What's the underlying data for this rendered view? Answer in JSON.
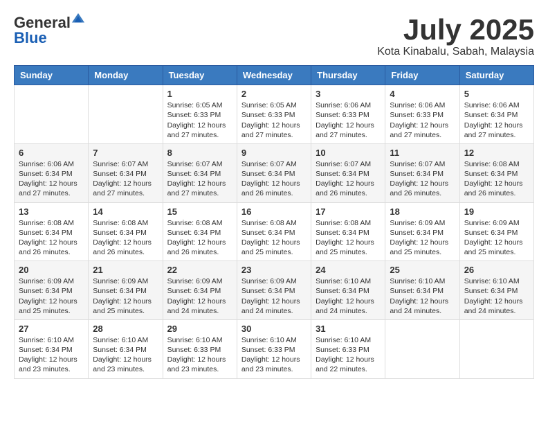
{
  "logo": {
    "general": "General",
    "blue": "Blue"
  },
  "header": {
    "month": "July 2025",
    "location": "Kota Kinabalu, Sabah, Malaysia"
  },
  "days_of_week": [
    "Sunday",
    "Monday",
    "Tuesday",
    "Wednesday",
    "Thursday",
    "Friday",
    "Saturday"
  ],
  "weeks": [
    [
      {
        "day": "",
        "sunrise": "",
        "sunset": "",
        "daylight": ""
      },
      {
        "day": "",
        "sunrise": "",
        "sunset": "",
        "daylight": ""
      },
      {
        "day": "1",
        "sunrise": "Sunrise: 6:05 AM",
        "sunset": "Sunset: 6:33 PM",
        "daylight": "Daylight: 12 hours and 27 minutes."
      },
      {
        "day": "2",
        "sunrise": "Sunrise: 6:05 AM",
        "sunset": "Sunset: 6:33 PM",
        "daylight": "Daylight: 12 hours and 27 minutes."
      },
      {
        "day": "3",
        "sunrise": "Sunrise: 6:06 AM",
        "sunset": "Sunset: 6:33 PM",
        "daylight": "Daylight: 12 hours and 27 minutes."
      },
      {
        "day": "4",
        "sunrise": "Sunrise: 6:06 AM",
        "sunset": "Sunset: 6:33 PM",
        "daylight": "Daylight: 12 hours and 27 minutes."
      },
      {
        "day": "5",
        "sunrise": "Sunrise: 6:06 AM",
        "sunset": "Sunset: 6:34 PM",
        "daylight": "Daylight: 12 hours and 27 minutes."
      }
    ],
    [
      {
        "day": "6",
        "sunrise": "Sunrise: 6:06 AM",
        "sunset": "Sunset: 6:34 PM",
        "daylight": "Daylight: 12 hours and 27 minutes."
      },
      {
        "day": "7",
        "sunrise": "Sunrise: 6:07 AM",
        "sunset": "Sunset: 6:34 PM",
        "daylight": "Daylight: 12 hours and 27 minutes."
      },
      {
        "day": "8",
        "sunrise": "Sunrise: 6:07 AM",
        "sunset": "Sunset: 6:34 PM",
        "daylight": "Daylight: 12 hours and 27 minutes."
      },
      {
        "day": "9",
        "sunrise": "Sunrise: 6:07 AM",
        "sunset": "Sunset: 6:34 PM",
        "daylight": "Daylight: 12 hours and 26 minutes."
      },
      {
        "day": "10",
        "sunrise": "Sunrise: 6:07 AM",
        "sunset": "Sunset: 6:34 PM",
        "daylight": "Daylight: 12 hours and 26 minutes."
      },
      {
        "day": "11",
        "sunrise": "Sunrise: 6:07 AM",
        "sunset": "Sunset: 6:34 PM",
        "daylight": "Daylight: 12 hours and 26 minutes."
      },
      {
        "day": "12",
        "sunrise": "Sunrise: 6:08 AM",
        "sunset": "Sunset: 6:34 PM",
        "daylight": "Daylight: 12 hours and 26 minutes."
      }
    ],
    [
      {
        "day": "13",
        "sunrise": "Sunrise: 6:08 AM",
        "sunset": "Sunset: 6:34 PM",
        "daylight": "Daylight: 12 hours and 26 minutes."
      },
      {
        "day": "14",
        "sunrise": "Sunrise: 6:08 AM",
        "sunset": "Sunset: 6:34 PM",
        "daylight": "Daylight: 12 hours and 26 minutes."
      },
      {
        "day": "15",
        "sunrise": "Sunrise: 6:08 AM",
        "sunset": "Sunset: 6:34 PM",
        "daylight": "Daylight: 12 hours and 26 minutes."
      },
      {
        "day": "16",
        "sunrise": "Sunrise: 6:08 AM",
        "sunset": "Sunset: 6:34 PM",
        "daylight": "Daylight: 12 hours and 25 minutes."
      },
      {
        "day": "17",
        "sunrise": "Sunrise: 6:08 AM",
        "sunset": "Sunset: 6:34 PM",
        "daylight": "Daylight: 12 hours and 25 minutes."
      },
      {
        "day": "18",
        "sunrise": "Sunrise: 6:09 AM",
        "sunset": "Sunset: 6:34 PM",
        "daylight": "Daylight: 12 hours and 25 minutes."
      },
      {
        "day": "19",
        "sunrise": "Sunrise: 6:09 AM",
        "sunset": "Sunset: 6:34 PM",
        "daylight": "Daylight: 12 hours and 25 minutes."
      }
    ],
    [
      {
        "day": "20",
        "sunrise": "Sunrise: 6:09 AM",
        "sunset": "Sunset: 6:34 PM",
        "daylight": "Daylight: 12 hours and 25 minutes."
      },
      {
        "day": "21",
        "sunrise": "Sunrise: 6:09 AM",
        "sunset": "Sunset: 6:34 PM",
        "daylight": "Daylight: 12 hours and 25 minutes."
      },
      {
        "day": "22",
        "sunrise": "Sunrise: 6:09 AM",
        "sunset": "Sunset: 6:34 PM",
        "daylight": "Daylight: 12 hours and 24 minutes."
      },
      {
        "day": "23",
        "sunrise": "Sunrise: 6:09 AM",
        "sunset": "Sunset: 6:34 PM",
        "daylight": "Daylight: 12 hours and 24 minutes."
      },
      {
        "day": "24",
        "sunrise": "Sunrise: 6:10 AM",
        "sunset": "Sunset: 6:34 PM",
        "daylight": "Daylight: 12 hours and 24 minutes."
      },
      {
        "day": "25",
        "sunrise": "Sunrise: 6:10 AM",
        "sunset": "Sunset: 6:34 PM",
        "daylight": "Daylight: 12 hours and 24 minutes."
      },
      {
        "day": "26",
        "sunrise": "Sunrise: 6:10 AM",
        "sunset": "Sunset: 6:34 PM",
        "daylight": "Daylight: 12 hours and 24 minutes."
      }
    ],
    [
      {
        "day": "27",
        "sunrise": "Sunrise: 6:10 AM",
        "sunset": "Sunset: 6:34 PM",
        "daylight": "Daylight: 12 hours and 23 minutes."
      },
      {
        "day": "28",
        "sunrise": "Sunrise: 6:10 AM",
        "sunset": "Sunset: 6:34 PM",
        "daylight": "Daylight: 12 hours and 23 minutes."
      },
      {
        "day": "29",
        "sunrise": "Sunrise: 6:10 AM",
        "sunset": "Sunset: 6:33 PM",
        "daylight": "Daylight: 12 hours and 23 minutes."
      },
      {
        "day": "30",
        "sunrise": "Sunrise: 6:10 AM",
        "sunset": "Sunset: 6:33 PM",
        "daylight": "Daylight: 12 hours and 23 minutes."
      },
      {
        "day": "31",
        "sunrise": "Sunrise: 6:10 AM",
        "sunset": "Sunset: 6:33 PM",
        "daylight": "Daylight: 12 hours and 22 minutes."
      },
      {
        "day": "",
        "sunrise": "",
        "sunset": "",
        "daylight": ""
      },
      {
        "day": "",
        "sunrise": "",
        "sunset": "",
        "daylight": ""
      }
    ]
  ]
}
